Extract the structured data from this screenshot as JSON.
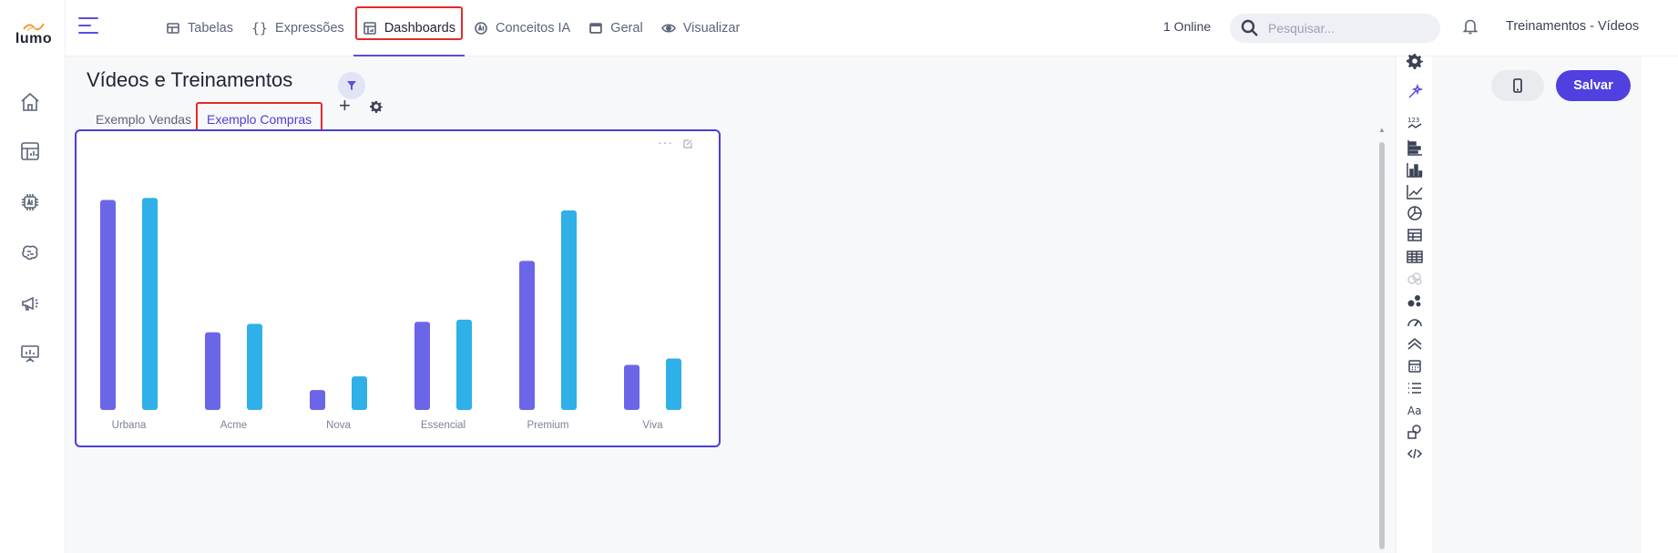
{
  "brand": {
    "name": "lumo"
  },
  "nav": {
    "tabs": [
      {
        "label": "Tabelas",
        "icon": "table-icon"
      },
      {
        "label": "Expressões",
        "icon": "braces-icon"
      },
      {
        "label": "Dashboards",
        "icon": "dashboard-icon",
        "active": true
      },
      {
        "label": "Conceitos IA",
        "icon": "ai-chip-icon"
      },
      {
        "label": "Geral",
        "icon": "window-icon"
      },
      {
        "label": "Visualizar",
        "icon": "eye-icon"
      }
    ]
  },
  "header": {
    "online": "1 Online",
    "search_placeholder": "Pesquisar...",
    "project_name": "Treinamentos - Vídeos"
  },
  "page": {
    "title": "Vídeos e Treinamentos",
    "save_label": "Salvar"
  },
  "dashboard_tabs": [
    {
      "label": "Exemplo Vendas"
    },
    {
      "label": "Exemplo Compras",
      "active": true
    }
  ],
  "card": {
    "more": "···"
  },
  "colors": {
    "accent": "#5040e0",
    "series1": "#6b66e8",
    "series2": "#2fb0e8",
    "highlight": "#e32b2b"
  },
  "chart_data": {
    "type": "bar",
    "categories": [
      "Urbana",
      "Acme",
      "Nova",
      "Essencial",
      "Premium",
      "Viva"
    ],
    "series": [
      {
        "values": [
          100,
          37,
          9.5,
          42,
          71,
          21.5
        ],
        "color": "#6b66e8"
      },
      {
        "values": [
          101,
          41,
          16,
          43,
          95,
          24.5
        ],
        "color": "#2fb0e8"
      }
    ],
    "ylim": [
      0,
      105
    ],
    "grid": false
  }
}
